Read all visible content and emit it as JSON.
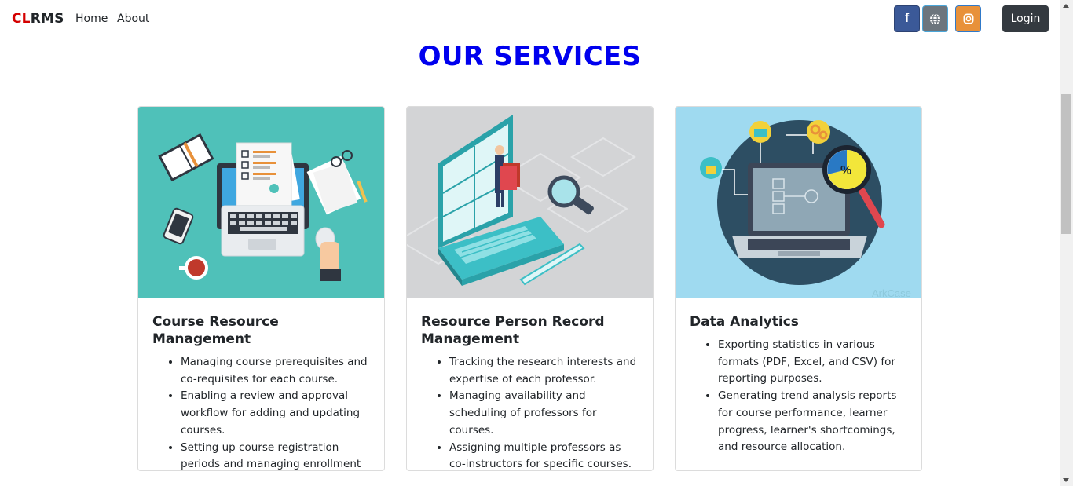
{
  "nav": {
    "brand_cl": "CL",
    "brand_rms": "RMS",
    "links": [
      "Home",
      "About"
    ],
    "social": [
      {
        "icon": "facebook-icon",
        "glyph": "f",
        "color": "#3b5998"
      },
      {
        "icon": "globe-icon",
        "color": "#6c757d"
      },
      {
        "icon": "instagram-icon",
        "color": "#e8913a"
      }
    ],
    "login_label": "Login"
  },
  "section_title": "OUR SERVICES",
  "title_color": "#0000ee",
  "cards": [
    {
      "title": "Course Resource Management",
      "items": [
        "Managing course prerequisites and co-requisites for each course.",
        "Enabling a review and approval workflow for adding and updating courses.",
        "Setting up course registration periods and managing enrollment limits."
      ]
    },
    {
      "title": "Resource Person Record Management",
      "items": [
        "Tracking the research interests and expertise of each professor.",
        "Managing availability and scheduling of professors for courses.",
        "Assigning multiple professors as co-instructors for specific courses."
      ]
    },
    {
      "title": "Data Analytics",
      "watermark": "ArkCase",
      "items": [
        "Exporting statistics in various formats (PDF, Excel, and CSV) for reporting purposes.",
        "Generating trend analysis reports for course performance, learner progress, learner's shortcomings, and resource allocation."
      ]
    }
  ]
}
